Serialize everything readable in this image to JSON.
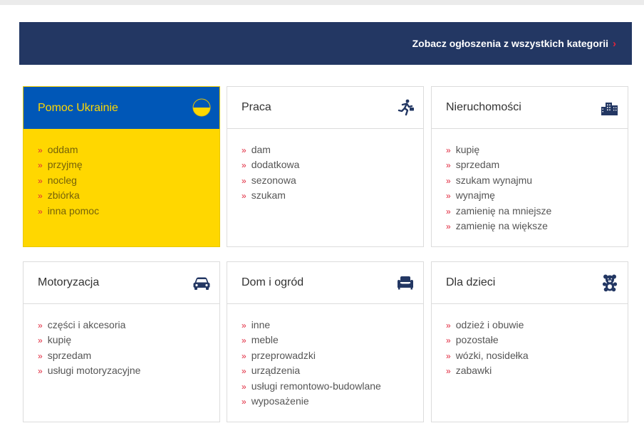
{
  "banner": {
    "link_text": "Zobacz ogłoszenia z wszystkich kategorii",
    "chevron": "›"
  },
  "colors": {
    "banner_bg": "#233763",
    "accent_red": "#e0243a",
    "ukraine_blue": "#0057b7",
    "ukraine_yellow": "#ffd700",
    "icon_navy": "#233763"
  },
  "categories": [
    {
      "title": "Pomoc Ukrainie",
      "icon": "ukraine-flag-icon",
      "items": [
        "oddam",
        "przyjmę",
        "nocleg",
        "zbiórka",
        "inna pomoc"
      ]
    },
    {
      "title": "Praca",
      "icon": "running-man-icon",
      "items": [
        "dam",
        "dodatkowa",
        "sezonowa",
        "szukam"
      ]
    },
    {
      "title": "Nieruchomości",
      "icon": "buildings-icon",
      "items": [
        "kupię",
        "sprzedam",
        "szukam wynajmu",
        "wynajmę",
        "zamienię na mniejsze",
        "zamienię na większe"
      ]
    },
    {
      "title": "Motoryzacja",
      "icon": "car-icon",
      "items": [
        "części i akcesoria",
        "kupię",
        "sprzedam",
        "usługi motoryzacyjne"
      ]
    },
    {
      "title": "Dom i ogród",
      "icon": "armchair-icon",
      "items": [
        "inne",
        "meble",
        "przeprowadzki",
        "urządzenia",
        "usługi remontowo-budowlane",
        "wyposażenie"
      ]
    },
    {
      "title": "Dla dzieci",
      "icon": "teddy-bear-icon",
      "items": [
        "odzież i obuwie",
        "pozostałe",
        "wózki, nosidełka",
        "zabawki"
      ]
    }
  ],
  "bullet_glyph": "»"
}
